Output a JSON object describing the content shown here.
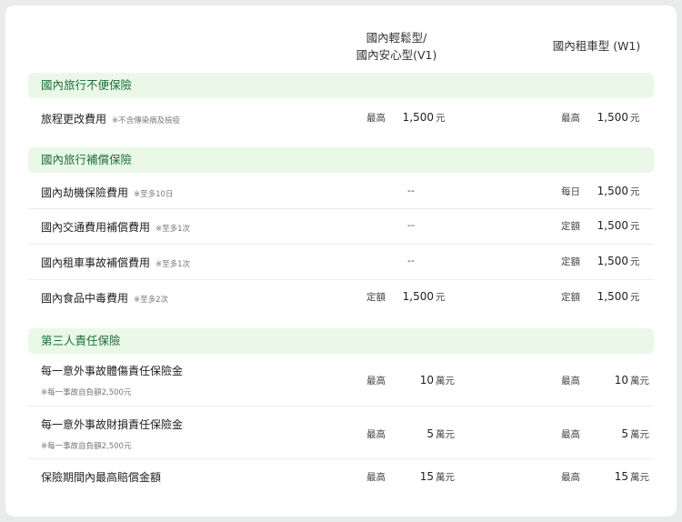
{
  "columns": {
    "v1_line1": "國內輕鬆型/",
    "v1_line2": "國內安心型(V1)",
    "w1": "國內租車型 (W1)"
  },
  "sections": [
    {
      "title": "國內旅行不便保險",
      "rows": [
        {
          "label": "旅程更改費用",
          "note": "※不含傳染病及檢疫",
          "v1": {
            "prefix": "最高",
            "amount": "1,500",
            "unit": "元"
          },
          "w1": {
            "prefix": "最高",
            "amount": "1,500",
            "unit": "元"
          }
        }
      ]
    },
    {
      "title": "國內旅行補償保險",
      "rows": [
        {
          "label": "國內劫機保險費用",
          "note": "※至多10日",
          "v1": {
            "dash": "--"
          },
          "w1": {
            "prefix": "每日",
            "amount": "1,500",
            "unit": "元"
          }
        },
        {
          "label": "國內交通費用補償費用",
          "note": "※至多1次",
          "v1": {
            "dash": "--"
          },
          "w1": {
            "prefix": "定額",
            "amount": "1,500",
            "unit": "元"
          }
        },
        {
          "label": "國內租車事故補償費用",
          "note": "※至多1次",
          "v1": {
            "dash": "--"
          },
          "w1": {
            "prefix": "定額",
            "amount": "1,500",
            "unit": "元"
          }
        },
        {
          "label": "國內食品中毒費用",
          "note": "※至多2次",
          "v1": {
            "prefix": "定額",
            "amount": "1,500",
            "unit": "元"
          },
          "w1": {
            "prefix": "定額",
            "amount": "1,500",
            "unit": "元"
          }
        }
      ]
    },
    {
      "title": "第三人責任保險",
      "rows": [
        {
          "label": "每一意外事故體傷責任保險金",
          "subnote": "※每一事故自負額2,500元",
          "v1": {
            "prefix": "最高",
            "amount": "10",
            "unit": "萬元"
          },
          "w1": {
            "prefix": "最高",
            "amount": "10",
            "unit": "萬元"
          }
        },
        {
          "label": "每一意外事故財損責任保險金",
          "subnote": "※每一事故自負額2,500元",
          "v1": {
            "prefix": "最高",
            "amount": "5",
            "unit": "萬元"
          },
          "w1": {
            "prefix": "最高",
            "amount": "5",
            "unit": "萬元"
          }
        },
        {
          "label": "保險期間內最高賠償金額",
          "v1": {
            "prefix": "最高",
            "amount": "15",
            "unit": "萬元"
          },
          "w1": {
            "prefix": "最高",
            "amount": "15",
            "unit": "萬元"
          }
        }
      ]
    }
  ]
}
